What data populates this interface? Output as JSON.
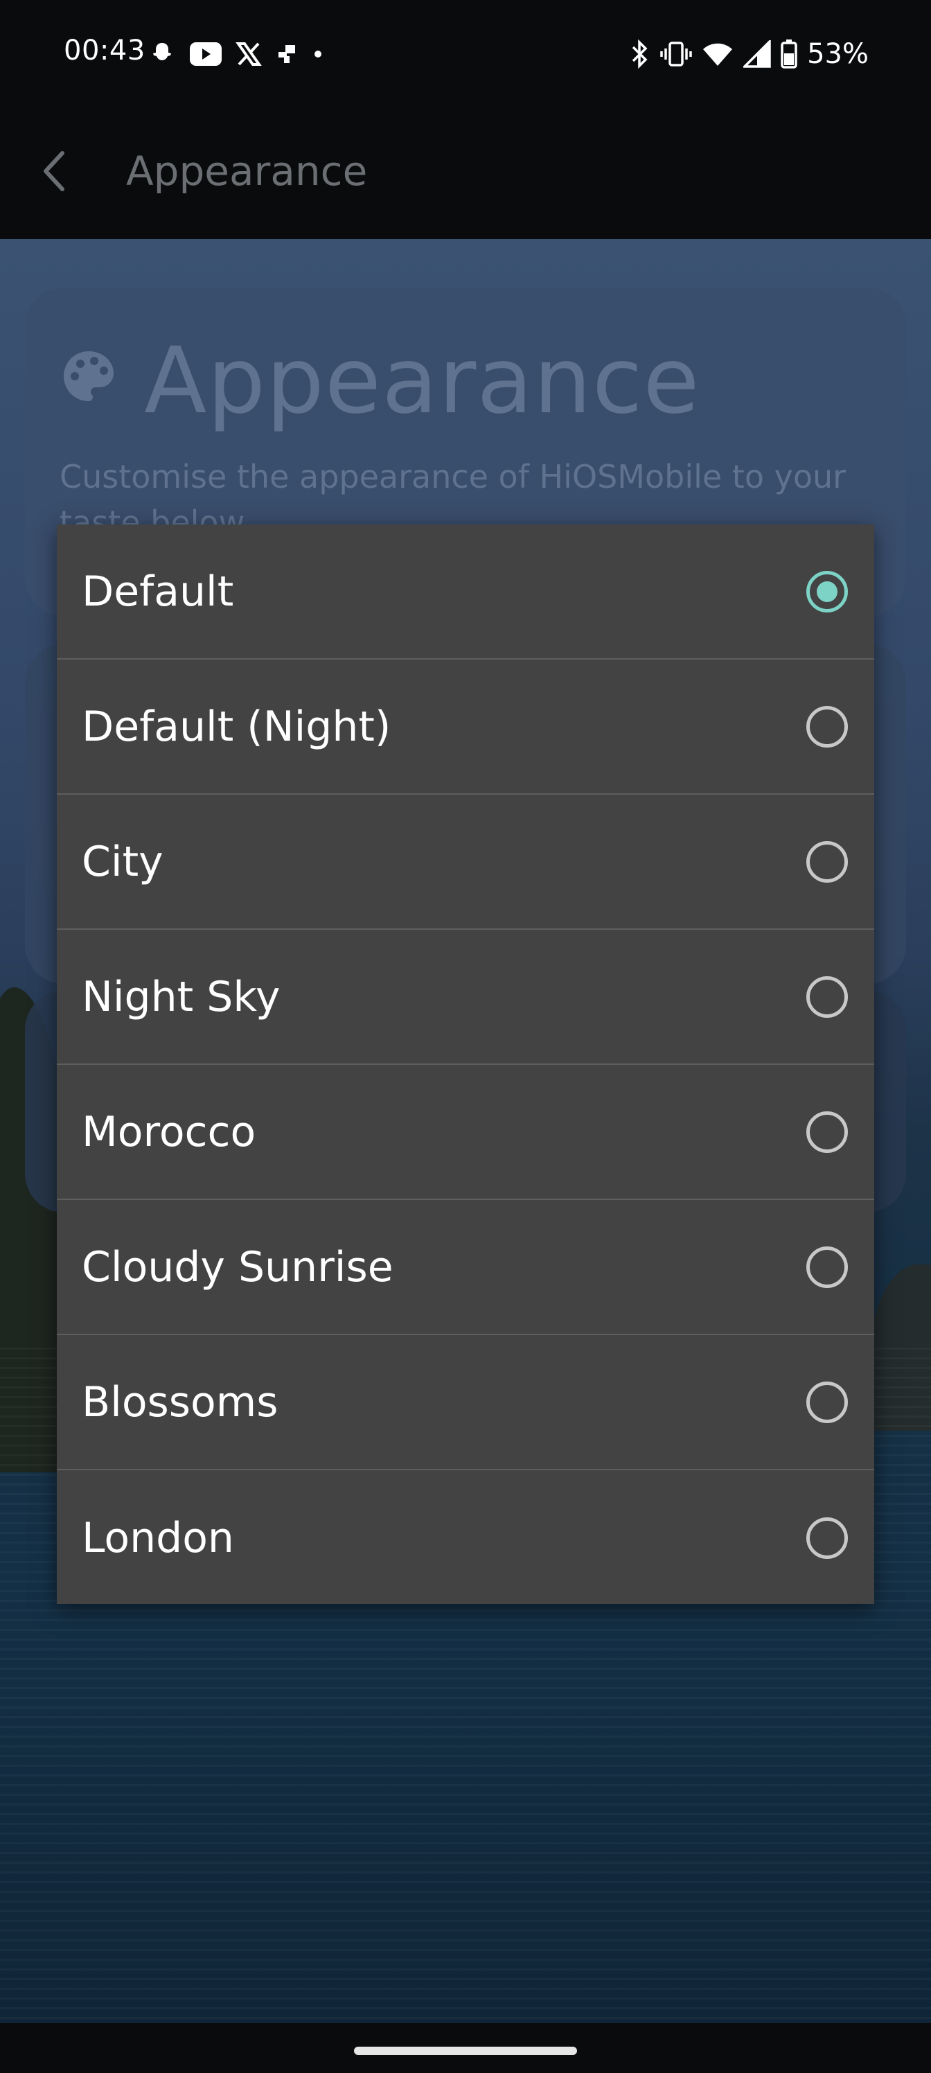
{
  "status_bar": {
    "time": "00:43",
    "left_icons": [
      "snapchat-icon",
      "youtube-icon",
      "x-icon",
      "app-icon",
      "dot-icon"
    ],
    "right_icons": [
      "bluetooth-icon",
      "vibrate-icon",
      "wifi-icon",
      "signal-icon",
      "battery-icon"
    ],
    "battery": "53%"
  },
  "app_bar": {
    "title": "Appearance"
  },
  "header_card": {
    "title": "Appearance",
    "subtitle": "Customise the appearance of HiOSMobile to your taste below."
  },
  "dialog": {
    "selected_index": 0,
    "accent_color": "#7dd3c6",
    "options": [
      {
        "label": "Default"
      },
      {
        "label": "Default (Night)"
      },
      {
        "label": "City"
      },
      {
        "label": "Night Sky"
      },
      {
        "label": "Morocco"
      },
      {
        "label": "Cloudy Sunrise"
      },
      {
        "label": "Blossoms"
      },
      {
        "label": "London"
      }
    ]
  }
}
